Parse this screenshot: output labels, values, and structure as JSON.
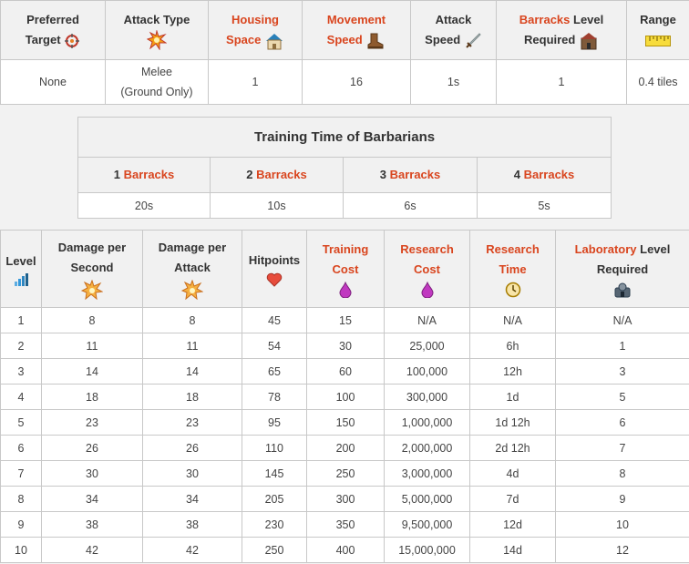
{
  "stats": {
    "headers": [
      {
        "pre": "Preferred",
        "line2": "Target",
        "link": "",
        "post": "",
        "icon": "target-icon"
      },
      {
        "pre": "Attack Type",
        "line2": "",
        "link": "",
        "post": "",
        "icon": "explosion-icon"
      },
      {
        "pre": "",
        "link": "Housing",
        "line2link": "Space",
        "icon": "house-icon"
      },
      {
        "pre": "",
        "link": "Movement",
        "line2link": "Speed",
        "icon": "boot-icon"
      },
      {
        "pre": "Attack",
        "line2": "Speed",
        "icon": "sword-icon"
      },
      {
        "link": "Barracks",
        "post": " Level",
        "line2": "Required",
        "icon": "barracks-icon"
      },
      {
        "pre": "Range",
        "icon": "ruler-icon"
      }
    ],
    "values": [
      "None",
      "Melee",
      "(Ground Only)",
      "1",
      "16",
      "1s",
      "1",
      "0.4 tiles"
    ]
  },
  "training": {
    "title": "Training Time of Barbarians",
    "columns": [
      {
        "num": "1 ",
        "label": "Barracks",
        "value": "20s"
      },
      {
        "num": "2 ",
        "label": "Barracks",
        "value": "10s"
      },
      {
        "num": "3 ",
        "label": "Barracks",
        "value": "6s"
      },
      {
        "num": "4 ",
        "label": "Barracks",
        "value": "5s"
      }
    ]
  },
  "levels": {
    "headers": {
      "level": "Level",
      "dps_1": "Damage per",
      "dps_2": "Second",
      "dpa_1": "Damage per",
      "dpa_2": "Attack",
      "hp": "Hitpoints",
      "tc_1": "Training",
      "tc_2": "Cost",
      "rc_1": "Research",
      "rc_2": "Cost",
      "rt_1": "Research",
      "rt_2": "Time",
      "lab_link": "Laboratory",
      "lab_post": " Level",
      "lab_2": "Required"
    },
    "rows": [
      [
        "1",
        "8",
        "8",
        "45",
        "15",
        "N/A",
        "N/A",
        "N/A"
      ],
      [
        "2",
        "11",
        "11",
        "54",
        "30",
        "25,000",
        "6h",
        "1"
      ],
      [
        "3",
        "14",
        "14",
        "65",
        "60",
        "100,000",
        "12h",
        "3"
      ],
      [
        "4",
        "18",
        "18",
        "78",
        "100",
        "300,000",
        "1d",
        "5"
      ],
      [
        "5",
        "23",
        "23",
        "95",
        "150",
        "1,000,000",
        "1d 12h",
        "6"
      ],
      [
        "6",
        "26",
        "26",
        "110",
        "200",
        "2,000,000",
        "2d 12h",
        "7"
      ],
      [
        "7",
        "30",
        "30",
        "145",
        "250",
        "3,000,000",
        "4d",
        "8"
      ],
      [
        "8",
        "34",
        "34",
        "205",
        "300",
        "5,000,000",
        "7d",
        "9"
      ],
      [
        "9",
        "38",
        "38",
        "230",
        "350",
        "9,500,000",
        "12d",
        "10"
      ],
      [
        "10",
        "42",
        "42",
        "250",
        "400",
        "15,000,000",
        "14d",
        "12"
      ]
    ]
  },
  "colors": {
    "link": "#d9451e",
    "header_bg": "#f1f1f1",
    "border": "#c8c8c8"
  }
}
